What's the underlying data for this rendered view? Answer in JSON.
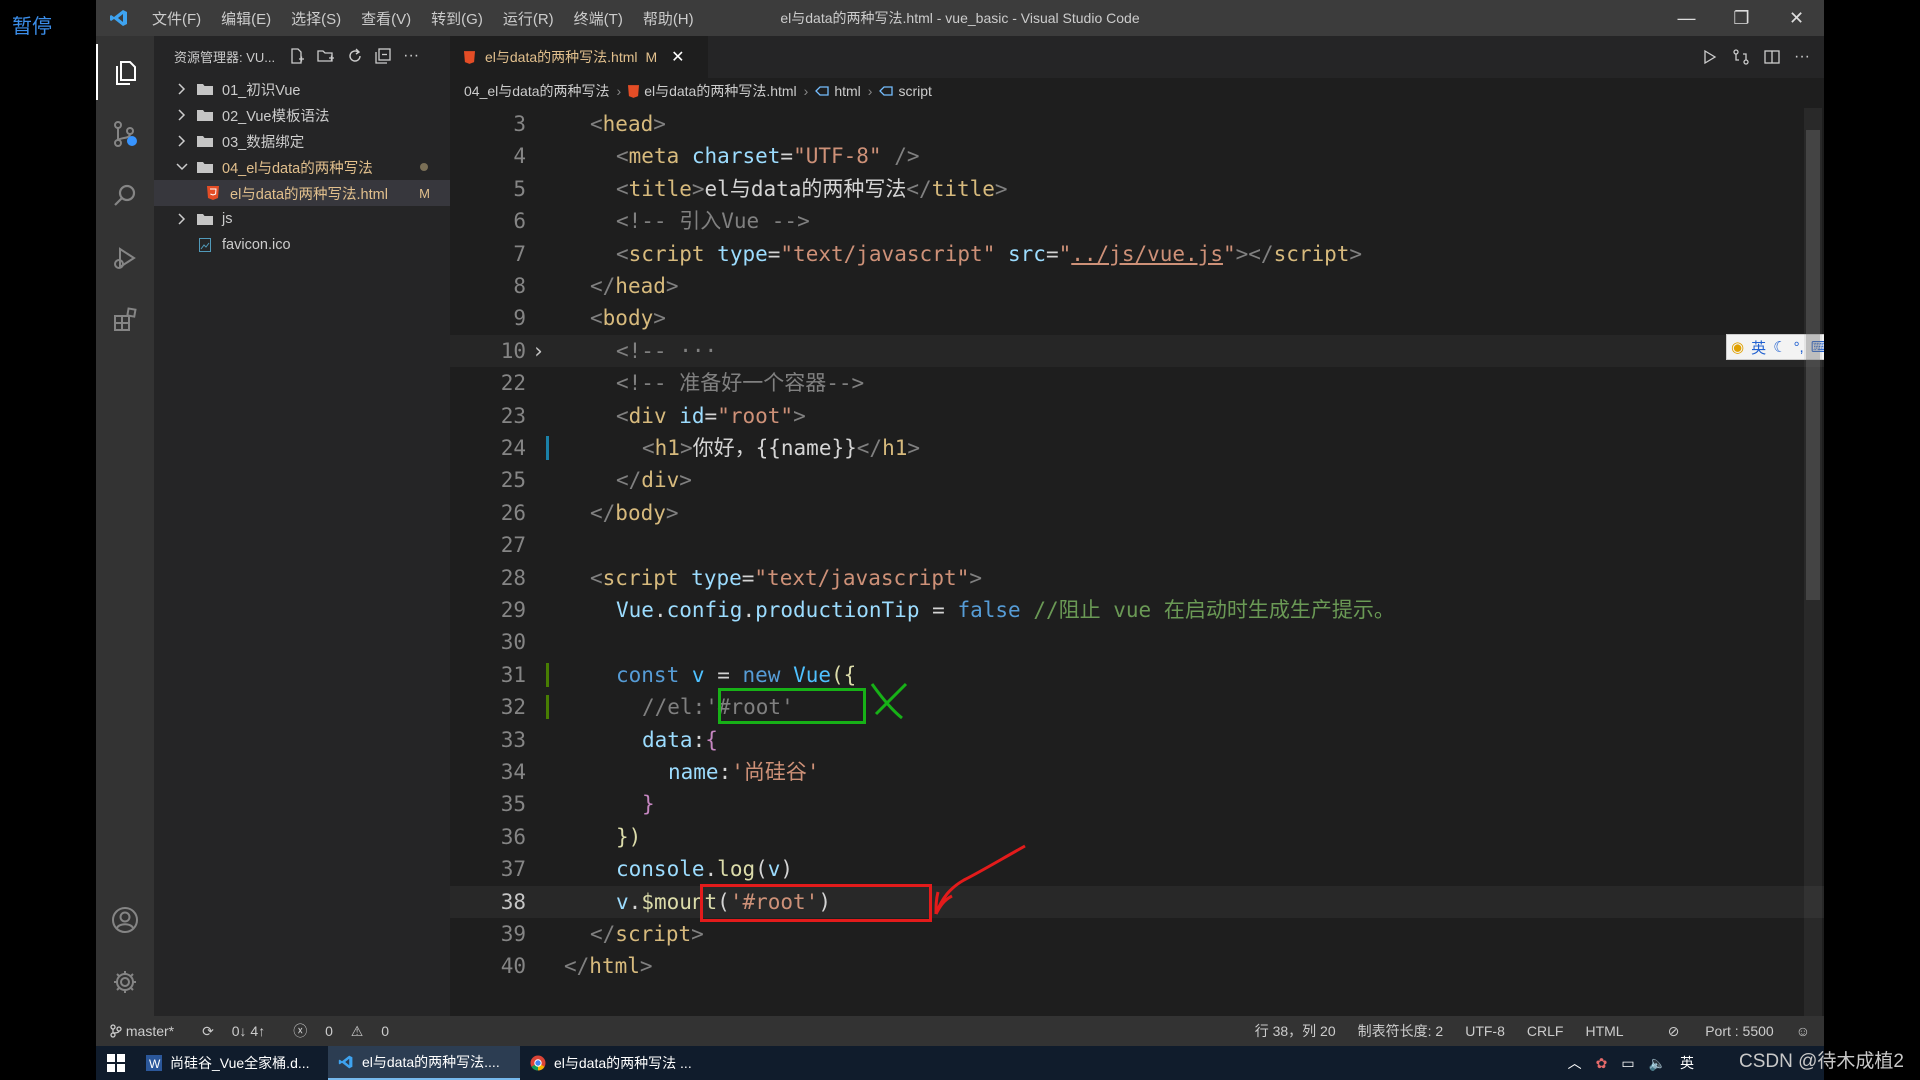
{
  "overlay": {
    "pause_label": "暂停",
    "watermark": "CSDN @待木成植2"
  },
  "window": {
    "title": "el与data的两种写法.html - vue_basic - Visual Studio Code"
  },
  "menu": [
    "文件(F)",
    "编辑(E)",
    "选择(S)",
    "查看(V)",
    "转到(G)",
    "运行(R)",
    "终端(T)",
    "帮助(H)"
  ],
  "explorer": {
    "header": "资源管理器: VU...",
    "items": [
      {
        "label": "01_初识Vue",
        "type": "folder",
        "expanded": false
      },
      {
        "label": "02_Vue模板语法",
        "type": "folder",
        "expanded": false
      },
      {
        "label": "03_数据绑定",
        "type": "folder",
        "expanded": false
      },
      {
        "label": "04_el与data的两种写法",
        "type": "folder",
        "expanded": true,
        "modified": true
      },
      {
        "label": "el与data的两种写法.html",
        "type": "file",
        "badge": "M",
        "selected": true
      },
      {
        "label": "js",
        "type": "folder",
        "expanded": false
      },
      {
        "label": "favicon.ico",
        "type": "file"
      }
    ]
  },
  "tab": {
    "label": "el与data的两种写法.html",
    "badge": "M",
    "close": "✕"
  },
  "breadcrumb": [
    "04_el与data的两种写法",
    "el与data的两种写法.html",
    "html",
    "script"
  ],
  "code": {
    "current_line": 38,
    "line_numbers": [
      "3",
      "4",
      "5",
      "6",
      "7",
      "8",
      "9",
      "10",
      "22",
      "23",
      "24",
      "25",
      "26",
      "27",
      "28",
      "29",
      "30",
      "31",
      "32",
      "33",
      "34",
      "35",
      "36",
      "37",
      "38",
      "39",
      "40"
    ]
  },
  "ime": {
    "lang": "英"
  },
  "statusbar": {
    "branch": "master*",
    "sync": "0↓ 4↑",
    "errors": "0",
    "warnings": "0",
    "position": "行 38，列 20",
    "tab_size": "制表符长度: 2",
    "encoding": "UTF-8",
    "eol": "CRLF",
    "language": "HTML",
    "port": "Port : 5500"
  },
  "taskbar": {
    "items": [
      {
        "label": "尚硅谷_Vue全家桶.d...",
        "app": "word"
      },
      {
        "label": "el与data的两种写法....",
        "app": "vscode",
        "active": true
      },
      {
        "label": "el与data的两种写法 ...",
        "app": "chrome"
      }
    ],
    "ime": "英"
  },
  "colors": {
    "accent": "#007acc",
    "annotation_green": "#17b117",
    "annotation_red": "#e31b1b"
  }
}
